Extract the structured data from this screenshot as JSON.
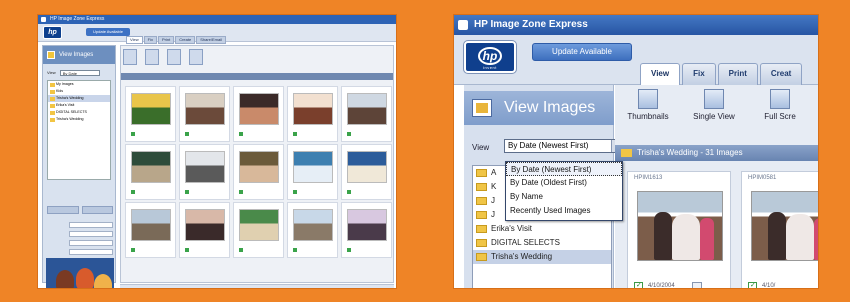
{
  "colors": {
    "background": "#ef8426",
    "accent_blue": "#2d63b5"
  },
  "left_window": {
    "title": "HP Image Zone Express",
    "logo_text": "hp",
    "update_label": "Update Available",
    "tabs": [
      "View",
      "Fix",
      "Print",
      "Create",
      "Share/Email"
    ],
    "sidebar_title": "View Images",
    "view_label": "View",
    "view_select_value": "By Date",
    "folders": [
      "My Images",
      "Kids",
      "Trisha's Wedding",
      "Erika's Visit",
      "DIGITAL SELECTS",
      "Trisha's Wedding"
    ],
    "thumbnail_count": 15
  },
  "right_window": {
    "title": "HP Image Zone Express",
    "logo_text": "hp",
    "logo_subtext": "invent",
    "update_button": "Update Available",
    "tabs": [
      "View",
      "Fix",
      "Print",
      "Creat"
    ],
    "sidebar_title": "View Images",
    "view_label": "View",
    "view_select_value": "By Date (Newest First)",
    "dropdown_options": [
      "By Date (Newest First)",
      "By Date (Oldest First)",
      "By Name",
      "Recently Used Images"
    ],
    "folders": [
      "A",
      "K",
      "J",
      "J",
      "Erika's Visit",
      "DIGITAL SELECTS",
      "Trisha's Wedding"
    ],
    "tools": [
      "Thumbnails",
      "Single View",
      "Full Scre"
    ],
    "group_header": "Trisha's Wedding - 31 Images",
    "cards": [
      {
        "caption": "HPIM1613",
        "date": "4/10/2004"
      },
      {
        "caption": "HPIM0581",
        "date": "4/10/"
      }
    ]
  }
}
